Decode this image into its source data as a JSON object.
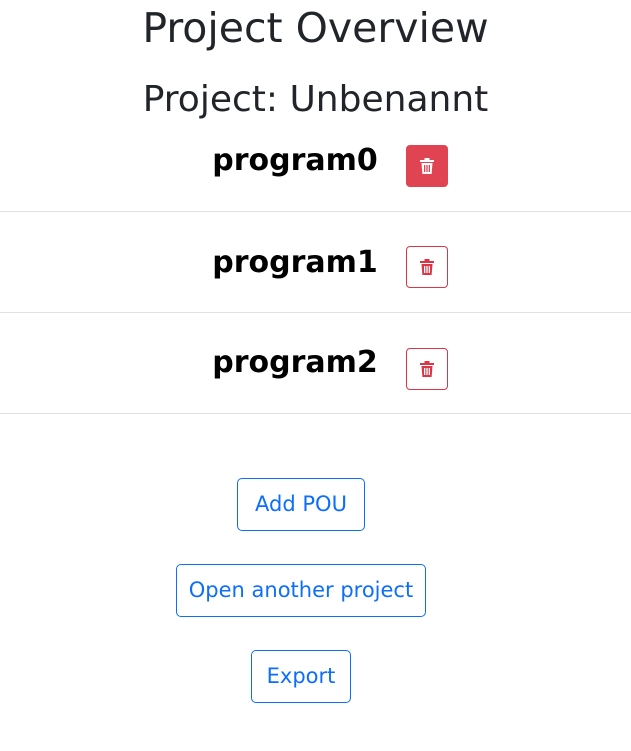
{
  "header": {
    "title": "Project Overview",
    "project_name": "Project: Unbenannt"
  },
  "programs": [
    {
      "name": "program0",
      "delete_icon": "trash-icon",
      "delete_state": "active"
    },
    {
      "name": "program1",
      "delete_icon": "trash-icon",
      "delete_state": "outline"
    },
    {
      "name": "program2",
      "delete_icon": "trash-icon",
      "delete_state": "outline"
    }
  ],
  "actions": {
    "add_pou": "Add POU",
    "open_project": "Open another project",
    "export": "Export"
  },
  "colors": {
    "danger": "#dc3545",
    "danger_active": "#e04452",
    "primary": "#0d6efd",
    "divider": "#dee2e6",
    "text": "#212529"
  }
}
